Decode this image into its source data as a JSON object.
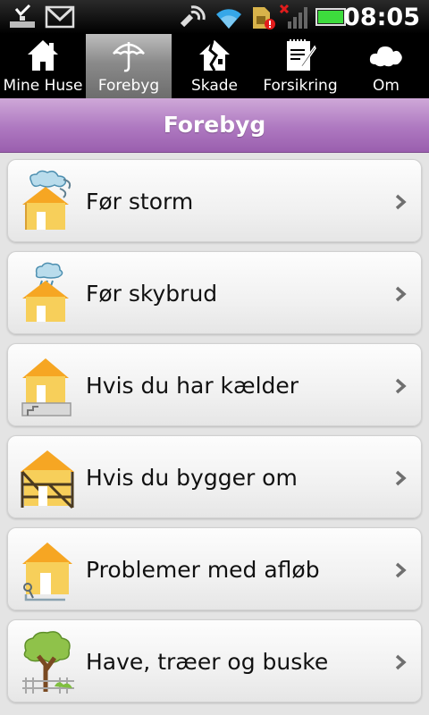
{
  "status_bar": {
    "time": "08:05",
    "icons": [
      "download-done-icon",
      "gmail-icon",
      "gps-icon",
      "wifi-icon",
      "sim-alert-icon",
      "no-signal-icon",
      "battery-icon"
    ]
  },
  "tabs": [
    {
      "label": "Mine Huse",
      "icon": "house-icon",
      "active": false
    },
    {
      "label": "Forebyg",
      "icon": "umbrella-icon",
      "active": true
    },
    {
      "label": "Skade",
      "icon": "broken-house-icon",
      "active": false
    },
    {
      "label": "Forsikring",
      "icon": "document-pen-icon",
      "active": false
    },
    {
      "label": "Om",
      "icon": "cloud-icon",
      "active": false
    }
  ],
  "header": {
    "title": "Forebyg"
  },
  "items": [
    {
      "label": "Før storm",
      "icon": "house-storm-icon"
    },
    {
      "label": "Før skybrud",
      "icon": "house-rain-icon"
    },
    {
      "label": "Hvis du har kælder",
      "icon": "house-basement-icon"
    },
    {
      "label": "Hvis du bygger om",
      "icon": "house-scaffold-icon"
    },
    {
      "label": "Problemer med afløb",
      "icon": "house-drain-icon"
    },
    {
      "label": "Have, træer og buske",
      "icon": "tree-fence-icon"
    }
  ],
  "colors": {
    "header_purple": "#ae78c0",
    "house_yellow": "#f5b82e",
    "active_tab": "#9a9a9a"
  }
}
